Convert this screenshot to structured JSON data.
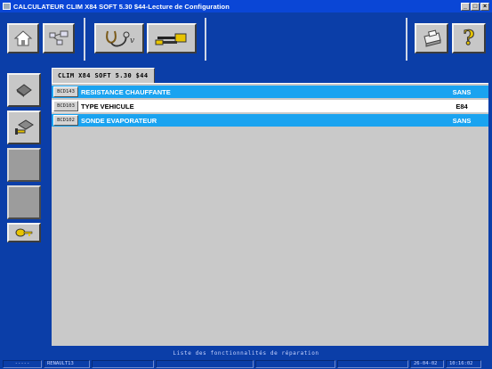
{
  "window": {
    "title": "CALCULATEUR CLIM X84 SOFT 5.30 $44-Lecture de Configuration",
    "controls": [
      "_",
      "□",
      "×"
    ]
  },
  "toolbar": {
    "left_buttons": [
      {
        "icon": "home-icon"
      },
      {
        "icon": "network-icon"
      },
      {
        "icon": "stethoscope-icon"
      },
      {
        "icon": "tools-icon"
      }
    ],
    "right_buttons": [
      {
        "icon": "printer-icon"
      },
      {
        "icon": "help-icon",
        "text": "?"
      }
    ]
  },
  "sidebar": {
    "buttons": [
      {
        "icon": "ecu-icon",
        "state": "enabled"
      },
      {
        "icon": "ecu-tools-icon",
        "state": "enabled"
      },
      {
        "icon": "blank",
        "state": "disabled"
      },
      {
        "icon": "blank",
        "state": "disabled"
      },
      {
        "icon": "key-icon",
        "state": "enabled"
      }
    ]
  },
  "main": {
    "tab_label": "CLIM X84 SOFT 5.30 $44",
    "rows": [
      {
        "code": "BCD143",
        "label": "RESISTANCE CHAUFFANTE",
        "value": "SANS",
        "style": "blue"
      },
      {
        "code": "BCD103",
        "label": "TYPE VEHICULE",
        "value": "E84",
        "style": "white"
      },
      {
        "code": "BCD102",
        "label": "SONDE EVAPORATEUR",
        "value": "SANS",
        "style": "blue"
      }
    ]
  },
  "status": {
    "message": "Liste des fonctionnalités de réparation",
    "cells": [
      "-----",
      "RENAULT13",
      "",
      "",
      "",
      "",
      "26-04-02",
      "10:16:02"
    ]
  },
  "colors": {
    "title_bar": "#0a46d6",
    "frame_blue": "#0b3ea8",
    "row_highlight": "#1aa3f0",
    "panel_gray": "#c9c9c9"
  }
}
